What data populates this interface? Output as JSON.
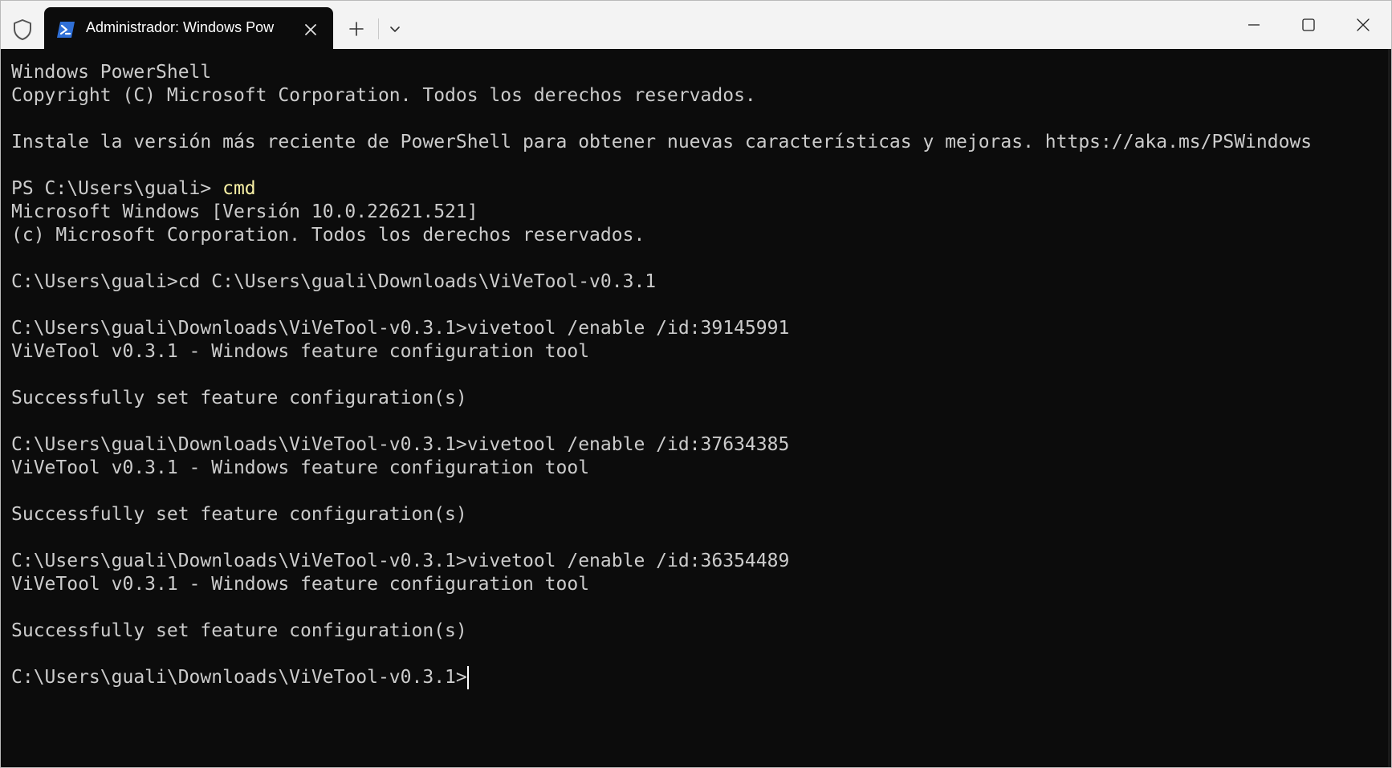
{
  "tab": {
    "title": "Administrador: Windows Pow"
  },
  "icons": {
    "shield": "shield-icon",
    "powershell": "powershell-icon",
    "close_tab": "close-icon",
    "new_tab": "plus-icon",
    "dropdown": "chevron-down-icon",
    "minimize": "minimize-icon",
    "maximize": "maximize-icon",
    "close_window": "close-icon"
  },
  "colors": {
    "terminal_bg": "#0c0c0c",
    "terminal_text": "#cccccc",
    "command_text": "#f9f1a5",
    "titlebar_bg": "#f3f3f3"
  },
  "terminal": {
    "lines": [
      {
        "text": "Windows PowerShell"
      },
      {
        "text": "Copyright (C) Microsoft Corporation. Todos los derechos reservados."
      },
      {
        "text": ""
      },
      {
        "text": "Instale la versión más reciente de PowerShell para obtener nuevas características y mejoras. https://aka.ms/PSWindows"
      },
      {
        "text": ""
      },
      {
        "prompt": "PS C:\\Users\\guali> ",
        "command": "cmd"
      },
      {
        "text": "Microsoft Windows [Versión 10.0.22621.521]"
      },
      {
        "text": "(c) Microsoft Corporation. Todos los derechos reservados."
      },
      {
        "text": ""
      },
      {
        "text": "C:\\Users\\guali>cd C:\\Users\\guali\\Downloads\\ViVeTool-v0.3.1"
      },
      {
        "text": ""
      },
      {
        "text": "C:\\Users\\guali\\Downloads\\ViVeTool-v0.3.1>vivetool /enable /id:39145991"
      },
      {
        "text": "ViVeTool v0.3.1 - Windows feature configuration tool"
      },
      {
        "text": ""
      },
      {
        "text": "Successfully set feature configuration(s)"
      },
      {
        "text": ""
      },
      {
        "text": "C:\\Users\\guali\\Downloads\\ViVeTool-v0.3.1>vivetool /enable /id:37634385"
      },
      {
        "text": "ViVeTool v0.3.1 - Windows feature configuration tool"
      },
      {
        "text": ""
      },
      {
        "text": "Successfully set feature configuration(s)"
      },
      {
        "text": ""
      },
      {
        "text": "C:\\Users\\guali\\Downloads\\ViVeTool-v0.3.1>vivetool /enable /id:36354489"
      },
      {
        "text": "ViVeTool v0.3.1 - Windows feature configuration tool"
      },
      {
        "text": ""
      },
      {
        "text": "Successfully set feature configuration(s)"
      },
      {
        "text": ""
      },
      {
        "text": "C:\\Users\\guali\\Downloads\\ViVeTool-v0.3.1>",
        "cursor": true
      }
    ]
  }
}
